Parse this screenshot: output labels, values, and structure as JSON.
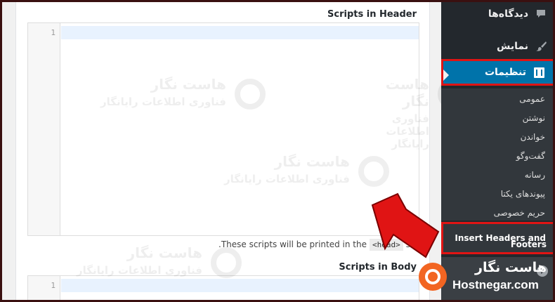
{
  "editor": {
    "header_title": "Scripts in Header",
    "body_title": "Scripts in Body",
    "line_number": "1",
    "help_before": ".These scripts will be printed in the",
    "help_code": "<head>",
    "help_after": "sec"
  },
  "watermark": {
    "line1": "هاست نگار",
    "line2": "فناوری اطلاعات رایانگار"
  },
  "sidebar": {
    "comments": "دیدگاه‌ها",
    "appearance": "نمایش",
    "settings": "تنظیمات",
    "submenu": [
      "عمومی",
      "نوشتن",
      "خواندن",
      "گفت‌وگو",
      "رسانه",
      "پیوندهای یکتا",
      "حریم خصوصی"
    ],
    "insert_headers_line1": "Insert Headers and",
    "insert_headers_line2": "Footers"
  },
  "brand": {
    "name": "هاست نگار",
    "domain": "Hostnegar.com"
  },
  "colors": {
    "sidebar_bg": "#23282d",
    "submenu_bg": "#32373c",
    "active_bg": "#0073aa",
    "highlight_border": "#e01414",
    "arrow": "#e01414",
    "brand_orange": "#f26522"
  }
}
